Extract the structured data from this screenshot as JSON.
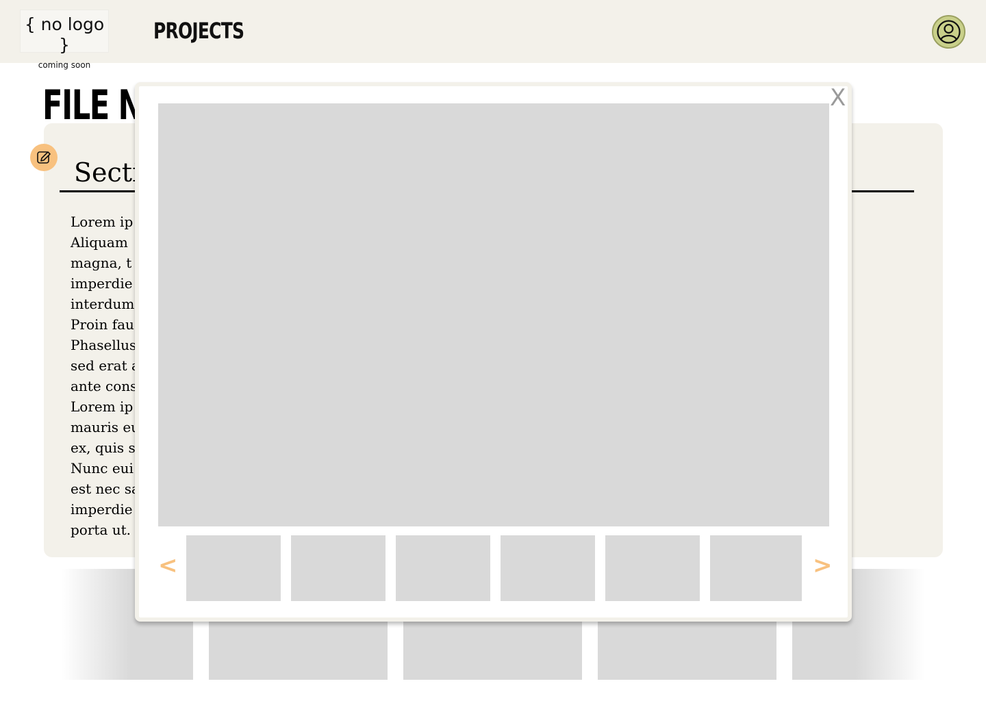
{
  "header": {
    "logo": {
      "main": "{ no logo }",
      "sub": "coming soon"
    },
    "nav_title": "PROJECTS"
  },
  "page": {
    "title": "FILE NM",
    "section_title": "Sectio",
    "body_text": "Lorem ip\nAliquam\nmagna, t\nimperdie\ninterdum\nProin fau\nPhasellus\nsed erat a\nante cons\nLorem ip\nmauris eu\nex, quis s\nNunc eui\nest nec sa\nimperdie\nporta ut."
  },
  "modal": {
    "close_label": "X",
    "prev_label": "<",
    "next_label": ">"
  },
  "colors": {
    "header_bg": "#f3f1ea",
    "card_bg": "#f3f1ea",
    "accent": "#f8c17f",
    "avatar": "#c9d08a",
    "placeholder": "#d9d9d9"
  }
}
